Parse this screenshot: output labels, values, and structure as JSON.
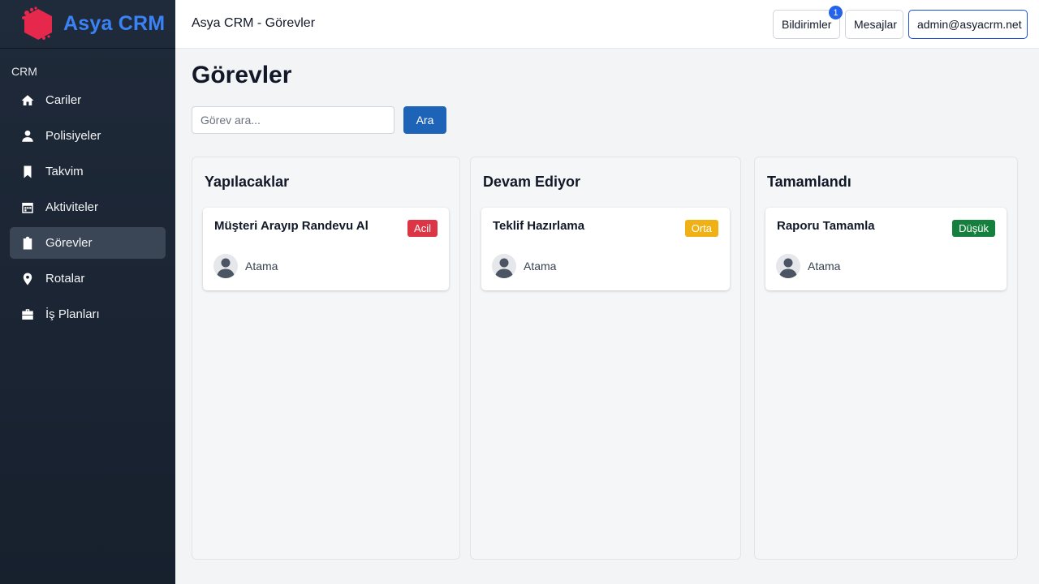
{
  "brand": {
    "name": "Asya CRM"
  },
  "header": {
    "title": "Asya CRM - Görevler",
    "notifications_label": "Bildirimler",
    "notifications_count": "1",
    "messages_label": "Mesajlar",
    "user_label": "admin@asyacrm.net"
  },
  "sidebar": {
    "section": "CRM",
    "items": [
      {
        "label": "Cariler",
        "icon": "home-icon"
      },
      {
        "label": "Polisiyeler",
        "icon": "user-icon"
      },
      {
        "label": "Takvim",
        "icon": "bookmark-icon"
      },
      {
        "label": "Aktiviteler",
        "icon": "calendar-icon"
      },
      {
        "label": "Görevler",
        "icon": "clipboard-icon",
        "active": true
      },
      {
        "label": "Rotalar",
        "icon": "map-pin-icon"
      },
      {
        "label": "İş Planları",
        "icon": "briefcase-icon"
      }
    ]
  },
  "main": {
    "title": "Görevler",
    "search": {
      "placeholder": "Görev ara...",
      "button": "Ara"
    },
    "columns": [
      {
        "title": "Yapılacaklar",
        "cards": [
          {
            "title": "Müşteri Arayıp Randevu Al",
            "priority": "Acil",
            "priority_color": "#dc3545",
            "assignee": "Atama"
          }
        ]
      },
      {
        "title": "Devam Ediyor",
        "cards": [
          {
            "title": "Teklif Hazırlama",
            "priority": "Orta",
            "priority_color": "#f0b114",
            "assignee": "Atama"
          }
        ]
      },
      {
        "title": "Tamamlandı",
        "cards": [
          {
            "title": "Raporu Tamamla",
            "priority": "Düşük",
            "priority_color": "#15803d",
            "assignee": "Atama"
          }
        ]
      }
    ]
  },
  "colors": {
    "accent": "#1d64b8",
    "sidebar_bg": "#1f2a3a",
    "brand": "#3b82f6"
  }
}
